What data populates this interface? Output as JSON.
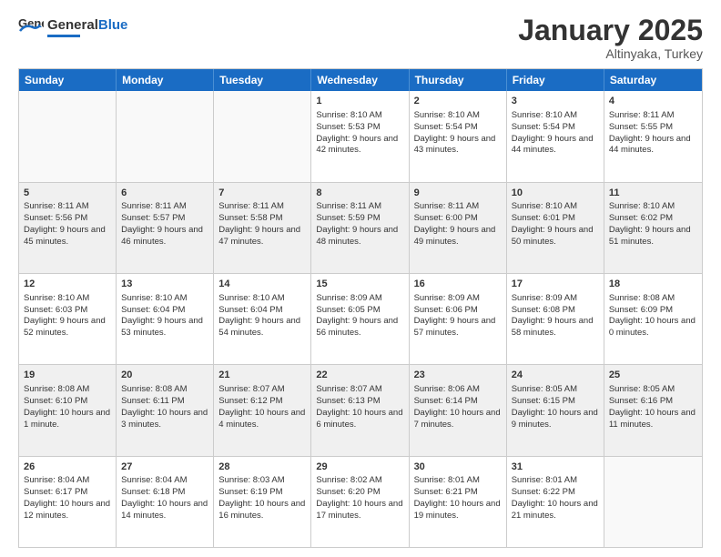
{
  "header": {
    "logo_general": "General",
    "logo_blue": "Blue",
    "title": "January 2025",
    "location": "Altinyaka, Turkey"
  },
  "weekdays": [
    "Sunday",
    "Monday",
    "Tuesday",
    "Wednesday",
    "Thursday",
    "Friday",
    "Saturday"
  ],
  "rows": [
    [
      {
        "day": "",
        "info": ""
      },
      {
        "day": "",
        "info": ""
      },
      {
        "day": "",
        "info": ""
      },
      {
        "day": "1",
        "info": "Sunrise: 8:10 AM\nSunset: 5:53 PM\nDaylight: 9 hours and 42 minutes."
      },
      {
        "day": "2",
        "info": "Sunrise: 8:10 AM\nSunset: 5:54 PM\nDaylight: 9 hours and 43 minutes."
      },
      {
        "day": "3",
        "info": "Sunrise: 8:10 AM\nSunset: 5:54 PM\nDaylight: 9 hours and 44 minutes."
      },
      {
        "day": "4",
        "info": "Sunrise: 8:11 AM\nSunset: 5:55 PM\nDaylight: 9 hours and 44 minutes."
      }
    ],
    [
      {
        "day": "5",
        "info": "Sunrise: 8:11 AM\nSunset: 5:56 PM\nDaylight: 9 hours and 45 minutes."
      },
      {
        "day": "6",
        "info": "Sunrise: 8:11 AM\nSunset: 5:57 PM\nDaylight: 9 hours and 46 minutes."
      },
      {
        "day": "7",
        "info": "Sunrise: 8:11 AM\nSunset: 5:58 PM\nDaylight: 9 hours and 47 minutes."
      },
      {
        "day": "8",
        "info": "Sunrise: 8:11 AM\nSunset: 5:59 PM\nDaylight: 9 hours and 48 minutes."
      },
      {
        "day": "9",
        "info": "Sunrise: 8:11 AM\nSunset: 6:00 PM\nDaylight: 9 hours and 49 minutes."
      },
      {
        "day": "10",
        "info": "Sunrise: 8:10 AM\nSunset: 6:01 PM\nDaylight: 9 hours and 50 minutes."
      },
      {
        "day": "11",
        "info": "Sunrise: 8:10 AM\nSunset: 6:02 PM\nDaylight: 9 hours and 51 minutes."
      }
    ],
    [
      {
        "day": "12",
        "info": "Sunrise: 8:10 AM\nSunset: 6:03 PM\nDaylight: 9 hours and 52 minutes."
      },
      {
        "day": "13",
        "info": "Sunrise: 8:10 AM\nSunset: 6:04 PM\nDaylight: 9 hours and 53 minutes."
      },
      {
        "day": "14",
        "info": "Sunrise: 8:10 AM\nSunset: 6:04 PM\nDaylight: 9 hours and 54 minutes."
      },
      {
        "day": "15",
        "info": "Sunrise: 8:09 AM\nSunset: 6:05 PM\nDaylight: 9 hours and 56 minutes."
      },
      {
        "day": "16",
        "info": "Sunrise: 8:09 AM\nSunset: 6:06 PM\nDaylight: 9 hours and 57 minutes."
      },
      {
        "day": "17",
        "info": "Sunrise: 8:09 AM\nSunset: 6:08 PM\nDaylight: 9 hours and 58 minutes."
      },
      {
        "day": "18",
        "info": "Sunrise: 8:08 AM\nSunset: 6:09 PM\nDaylight: 10 hours and 0 minutes."
      }
    ],
    [
      {
        "day": "19",
        "info": "Sunrise: 8:08 AM\nSunset: 6:10 PM\nDaylight: 10 hours and 1 minute."
      },
      {
        "day": "20",
        "info": "Sunrise: 8:08 AM\nSunset: 6:11 PM\nDaylight: 10 hours and 3 minutes."
      },
      {
        "day": "21",
        "info": "Sunrise: 8:07 AM\nSunset: 6:12 PM\nDaylight: 10 hours and 4 minutes."
      },
      {
        "day": "22",
        "info": "Sunrise: 8:07 AM\nSunset: 6:13 PM\nDaylight: 10 hours and 6 minutes."
      },
      {
        "day": "23",
        "info": "Sunrise: 8:06 AM\nSunset: 6:14 PM\nDaylight: 10 hours and 7 minutes."
      },
      {
        "day": "24",
        "info": "Sunrise: 8:05 AM\nSunset: 6:15 PM\nDaylight: 10 hours and 9 minutes."
      },
      {
        "day": "25",
        "info": "Sunrise: 8:05 AM\nSunset: 6:16 PM\nDaylight: 10 hours and 11 minutes."
      }
    ],
    [
      {
        "day": "26",
        "info": "Sunrise: 8:04 AM\nSunset: 6:17 PM\nDaylight: 10 hours and 12 minutes."
      },
      {
        "day": "27",
        "info": "Sunrise: 8:04 AM\nSunset: 6:18 PM\nDaylight: 10 hours and 14 minutes."
      },
      {
        "day": "28",
        "info": "Sunrise: 8:03 AM\nSunset: 6:19 PM\nDaylight: 10 hours and 16 minutes."
      },
      {
        "day": "29",
        "info": "Sunrise: 8:02 AM\nSunset: 6:20 PM\nDaylight: 10 hours and 17 minutes."
      },
      {
        "day": "30",
        "info": "Sunrise: 8:01 AM\nSunset: 6:21 PM\nDaylight: 10 hours and 19 minutes."
      },
      {
        "day": "31",
        "info": "Sunrise: 8:01 AM\nSunset: 6:22 PM\nDaylight: 10 hours and 21 minutes."
      },
      {
        "day": "",
        "info": ""
      }
    ]
  ]
}
